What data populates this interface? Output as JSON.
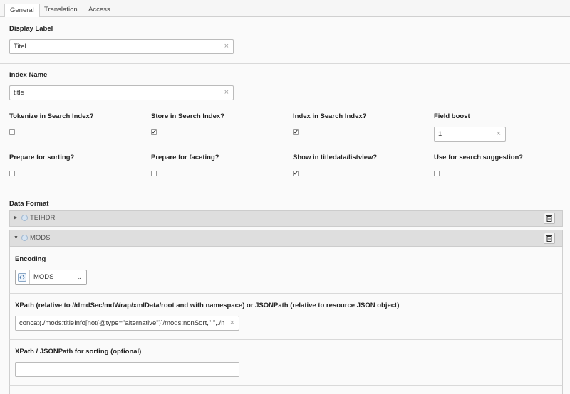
{
  "tabs": [
    {
      "label": "General",
      "active": true
    },
    {
      "label": "Translation",
      "active": false
    },
    {
      "label": "Access",
      "active": false
    }
  ],
  "display_label": {
    "label": "Display Label",
    "value": "Titel"
  },
  "index_name": {
    "label": "Index Name",
    "value": "title"
  },
  "options_row1": [
    {
      "label": "Tokenize in Search Index?",
      "checked": false
    },
    {
      "label": "Store in Search Index?",
      "checked": true
    },
    {
      "label": "Index in Search Index?",
      "checked": true
    }
  ],
  "field_boost": {
    "label": "Field boost",
    "value": "1"
  },
  "options_row2": [
    {
      "label": "Prepare for sorting?",
      "checked": false
    },
    {
      "label": "Prepare for faceting?",
      "checked": false
    },
    {
      "label": "Show in titledata/listview?",
      "checked": true
    },
    {
      "label": "Use for search suggestion?",
      "checked": false
    }
  ],
  "data_format": {
    "label": "Data Format",
    "records": [
      {
        "name": "TEIHDR",
        "expanded": false
      },
      {
        "name": "MODS",
        "expanded": true
      }
    ],
    "encoding": {
      "label": "Encoding",
      "value": "MODS"
    },
    "xpath": {
      "label": "XPath (relative to //dmdSec/mdWrap/xmlData/root and with namespace) or JSONPath (relative to resource JSON object)",
      "value": "concat(./mods:titleInfo[not(@type=\"alternative\")]/mods:nonSort,\" \",./m"
    },
    "xpath_sorting": {
      "label": "XPath / JSONPath for sorting (optional)",
      "value": ""
    }
  },
  "glyphs": {
    "clear": "×",
    "check": "✔",
    "collapsed": "▶",
    "expanded": "▼",
    "dropdown": "⌄"
  },
  "icons": {
    "record": "record-icon",
    "delete": "trash-icon",
    "select": "select-type-icon"
  }
}
